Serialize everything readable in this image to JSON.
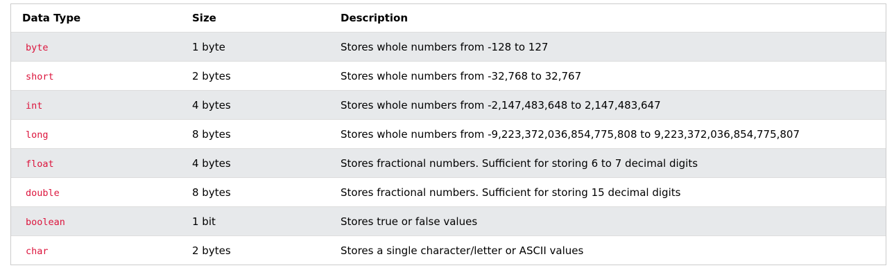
{
  "table": {
    "headers": [
      "Data Type",
      "Size",
      "Description"
    ],
    "rows": [
      {
        "type": "byte",
        "size": "1 byte",
        "description": "Stores whole numbers from -128 to 127"
      },
      {
        "type": "short",
        "size": "2 bytes",
        "description": "Stores whole numbers from -32,768 to 32,767"
      },
      {
        "type": "int",
        "size": "4 bytes",
        "description": "Stores whole numbers from -2,147,483,648 to 2,147,483,647"
      },
      {
        "type": "long",
        "size": "8 bytes",
        "description": "Stores whole numbers from -9,223,372,036,854,775,808 to 9,223,372,036,854,775,807"
      },
      {
        "type": "float",
        "size": "4 bytes",
        "description": "Stores fractional numbers. Sufficient for storing 6 to 7 decimal digits"
      },
      {
        "type": "double",
        "size": "8 bytes",
        "description": "Stores fractional numbers. Sufficient for storing 15 decimal digits"
      },
      {
        "type": "boolean",
        "size": "1 bit",
        "description": "Stores true or false values"
      },
      {
        "type": "char",
        "size": "2 bytes",
        "description": "Stores a single character/letter or ASCII values"
      }
    ]
  },
  "colors": {
    "code_text": "#dc143c",
    "stripe": "#e7e9eb",
    "border": "#dddddd"
  }
}
